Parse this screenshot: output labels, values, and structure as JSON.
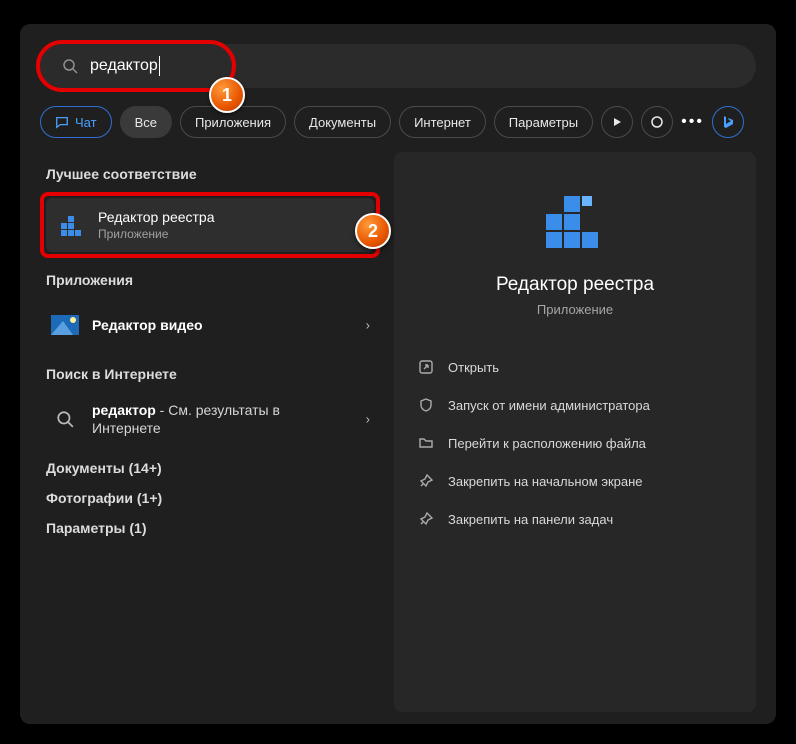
{
  "search": {
    "value": "редактор"
  },
  "filters": {
    "chat": "Чат",
    "all": "Все",
    "apps": "Приложения",
    "docs": "Документы",
    "internet": "Интернет",
    "settings": "Параметры"
  },
  "left": {
    "best_match": "Лучшее соответствие",
    "result1_title": "Редактор реестра",
    "result1_sub": "Приложение",
    "apps_head": "Приложения",
    "video_editor": "Редактор видео",
    "web_head": "Поиск в Интернете",
    "web_term": "редактор",
    "web_suffix": " - См. результаты в Интернете",
    "docs_head": "Документы (14+)",
    "photos_head": "Фотографии (1+)",
    "params_head": "Параметры (1)"
  },
  "preview": {
    "title": "Редактор реестра",
    "sub": "Приложение",
    "actions": {
      "open": "Открыть",
      "admin": "Запуск от имени администратора",
      "folder": "Перейти к расположению файла",
      "pin_start": "Закрепить на начальном экране",
      "pin_task": "Закрепить на панели задач"
    }
  },
  "callouts": {
    "one": "1",
    "two": "2"
  }
}
